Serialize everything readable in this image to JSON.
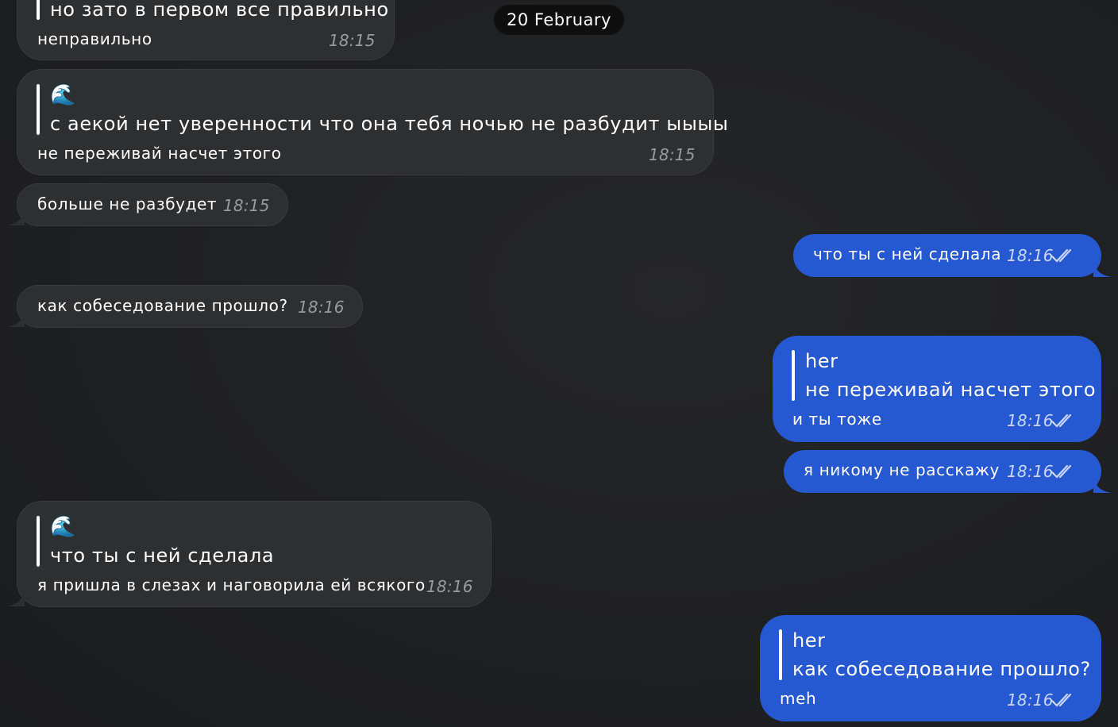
{
  "date_separator": "20 February",
  "colors": {
    "background": "#1f2022",
    "incoming_bubble": "#2e2f31",
    "outgoing_bubble": "#2659d1",
    "quote_bar": "#ffffff"
  },
  "messages": [
    {
      "direction": "incoming",
      "quote": {
        "author_emoji": "",
        "text": "но зато в первом все правильно"
      },
      "text": "неправильно",
      "time": "18:15"
    },
    {
      "direction": "incoming",
      "quote": {
        "author_emoji": "🌊",
        "text": "с аекой нет уверенности что она тебя ночью не разбудит ыыыы"
      },
      "text": "не переживай насчет этого",
      "time": "18:15"
    },
    {
      "direction": "incoming",
      "text": "больше не разбудет",
      "time": "18:15"
    },
    {
      "direction": "outgoing",
      "text": "что ты с ней сделала",
      "time": "18:16",
      "status": "read"
    },
    {
      "direction": "incoming",
      "text": "как собеседование прошло?",
      "time": "18:16"
    },
    {
      "direction": "outgoing",
      "quote": {
        "author": "her",
        "text": "не переживай насчет этого"
      },
      "text": "и ты тоже",
      "time": "18:16",
      "status": "read"
    },
    {
      "direction": "outgoing",
      "text": "я никому не расскажу",
      "time": "18:16",
      "status": "read"
    },
    {
      "direction": "incoming",
      "quote": {
        "author_emoji": "🌊",
        "text": "что ты с ней сделала"
      },
      "text": "я пришла в слезах и наговорила ей всякого",
      "time": "18:16"
    },
    {
      "direction": "outgoing",
      "quote": {
        "author": "her",
        "text": "как собеседование прошло?"
      },
      "text": "meh",
      "time": "18:16",
      "status": "read"
    }
  ]
}
